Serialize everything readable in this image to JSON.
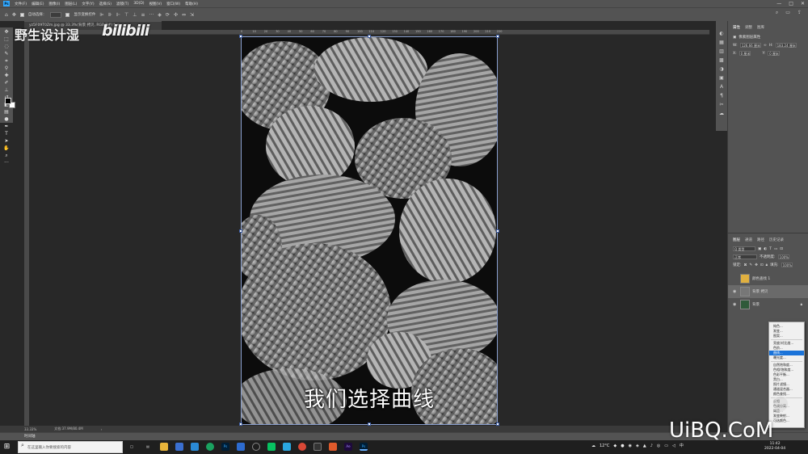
{
  "menu": {
    "app_logo": "Ps",
    "items": [
      "文件(F)",
      "编辑(E)",
      "图像(I)",
      "图层(L)",
      "文字(Y)",
      "选择(S)",
      "滤镜(T)",
      "3D(D)",
      "视图(V)",
      "窗口(W)",
      "帮助(H)"
    ],
    "window_controls": [
      "—",
      "□",
      "✕"
    ]
  },
  "options": {
    "auto_select_label": "自动选择：",
    "show_transform_label": "显示变换控件"
  },
  "doc_tab": {
    "title": "yz5F09T0Zm.jpg @ 33.3%(背景 拷贝, RGB/8#) *  ×"
  },
  "watermark": {
    "channel": "野生设计湿",
    "site_logo": "bilibili",
    "corner": "UiBQ.CoM"
  },
  "ruler": {
    "ticks": [
      "0",
      "10",
      "20",
      "30",
      "40",
      "50",
      "60",
      "70",
      "80",
      "90",
      "100",
      "110",
      "120",
      "130",
      "140",
      "150",
      "160",
      "170",
      "180",
      "190",
      "200",
      "210",
      "220"
    ]
  },
  "subtitle": "我们选择曲线",
  "status": {
    "zoom": "33.33%",
    "doc": "文档:37.9M/80.4M"
  },
  "timeline_tab": "时间轴",
  "properties": {
    "tabs": [
      "属性",
      "调整",
      "图库"
    ],
    "section": "像素图层属性",
    "w_label": "W:",
    "w_value": "126.66 厘米",
    "h_label": "H:",
    "h_value": "183.24 厘米",
    "x_label": "X:",
    "x_value": "0 厘米",
    "y_label": "Y:",
    "y_value": "0 厘米"
  },
  "layers": {
    "tabs": [
      "图层",
      "通道",
      "路径",
      "历史记录"
    ],
    "filter_label": "Q 类型",
    "blend_mode": "正常",
    "opacity_label": "不透明度:",
    "opacity_value": "100%",
    "lock_label": "锁定:",
    "fill_label": "填充:",
    "fill_value": "100%",
    "items": [
      {
        "name": "颜色查找 1"
      },
      {
        "name": "背景 拷贝"
      },
      {
        "name": "背景"
      }
    ]
  },
  "context_menu": {
    "items": [
      "纯色...",
      "渐变...",
      "图案...",
      "亮度/对比度...",
      "色阶...",
      "曲线...",
      "曝光度...",
      "自然饱和度...",
      "色相/饱和度...",
      "色彩平衡...",
      "黑白...",
      "照片滤镜...",
      "通道混合器...",
      "颜色查找...",
      "反相",
      "色调分离...",
      "阈值...",
      "渐变映射...",
      "可选颜色..."
    ],
    "highlighted_index": 5
  },
  "taskbar": {
    "search_placeholder": "在这里输入你要搜索的内容",
    "weather": "12°C",
    "time": "11:42",
    "date": "2022-04-04"
  },
  "colors": {
    "ps_blue": "#31a8ff",
    "menu_highlight": "#1a73d9",
    "panel_bg": "#535353",
    "canvas_bg": "#282828"
  }
}
